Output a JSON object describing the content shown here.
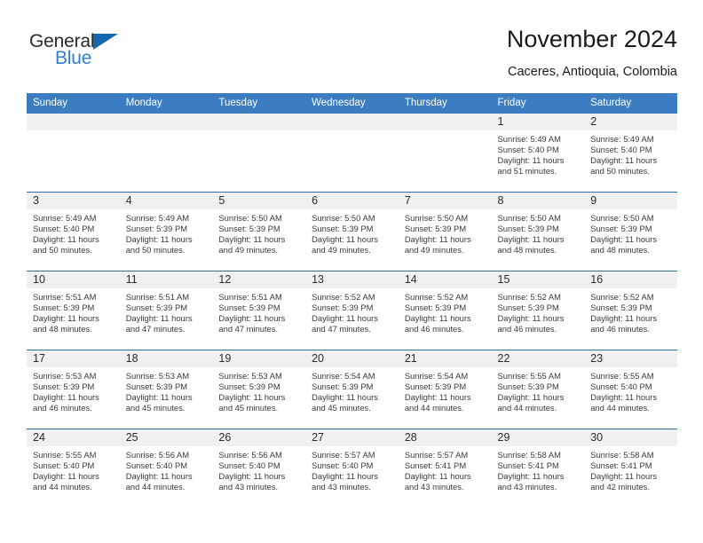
{
  "brand": {
    "name_part1": "General",
    "name_part2": "Blue",
    "triangle_icon": "triangle-icon",
    "color_dark": "#2b2b2b",
    "color_blue": "#2f7fd0",
    "triangle_color": "#1567b0"
  },
  "header": {
    "title": "November 2024",
    "subtitle": "Caceres, Antioquia, Colombia"
  },
  "theme": {
    "header_bg": "#3b7dc0",
    "header_text": "#ffffff",
    "row_divider": "#2f6fa8",
    "daynum_bg": "#f0f0f0",
    "body_text": "#3a3a3a"
  },
  "weekdays": [
    "Sunday",
    "Monday",
    "Tuesday",
    "Wednesday",
    "Thursday",
    "Friday",
    "Saturday"
  ],
  "weeks": [
    [
      {
        "day": "",
        "sunrise": "",
        "sunset": "",
        "daylight1": "",
        "daylight2": ""
      },
      {
        "day": "",
        "sunrise": "",
        "sunset": "",
        "daylight1": "",
        "daylight2": ""
      },
      {
        "day": "",
        "sunrise": "",
        "sunset": "",
        "daylight1": "",
        "daylight2": ""
      },
      {
        "day": "",
        "sunrise": "",
        "sunset": "",
        "daylight1": "",
        "daylight2": ""
      },
      {
        "day": "",
        "sunrise": "",
        "sunset": "",
        "daylight1": "",
        "daylight2": ""
      },
      {
        "day": "1",
        "sunrise": "Sunrise: 5:49 AM",
        "sunset": "Sunset: 5:40 PM",
        "daylight1": "Daylight: 11 hours",
        "daylight2": "and 51 minutes."
      },
      {
        "day": "2",
        "sunrise": "Sunrise: 5:49 AM",
        "sunset": "Sunset: 5:40 PM",
        "daylight1": "Daylight: 11 hours",
        "daylight2": "and 50 minutes."
      }
    ],
    [
      {
        "day": "3",
        "sunrise": "Sunrise: 5:49 AM",
        "sunset": "Sunset: 5:40 PM",
        "daylight1": "Daylight: 11 hours",
        "daylight2": "and 50 minutes."
      },
      {
        "day": "4",
        "sunrise": "Sunrise: 5:49 AM",
        "sunset": "Sunset: 5:39 PM",
        "daylight1": "Daylight: 11 hours",
        "daylight2": "and 50 minutes."
      },
      {
        "day": "5",
        "sunrise": "Sunrise: 5:50 AM",
        "sunset": "Sunset: 5:39 PM",
        "daylight1": "Daylight: 11 hours",
        "daylight2": "and 49 minutes."
      },
      {
        "day": "6",
        "sunrise": "Sunrise: 5:50 AM",
        "sunset": "Sunset: 5:39 PM",
        "daylight1": "Daylight: 11 hours",
        "daylight2": "and 49 minutes."
      },
      {
        "day": "7",
        "sunrise": "Sunrise: 5:50 AM",
        "sunset": "Sunset: 5:39 PM",
        "daylight1": "Daylight: 11 hours",
        "daylight2": "and 49 minutes."
      },
      {
        "day": "8",
        "sunrise": "Sunrise: 5:50 AM",
        "sunset": "Sunset: 5:39 PM",
        "daylight1": "Daylight: 11 hours",
        "daylight2": "and 48 minutes."
      },
      {
        "day": "9",
        "sunrise": "Sunrise: 5:50 AM",
        "sunset": "Sunset: 5:39 PM",
        "daylight1": "Daylight: 11 hours",
        "daylight2": "and 48 minutes."
      }
    ],
    [
      {
        "day": "10",
        "sunrise": "Sunrise: 5:51 AM",
        "sunset": "Sunset: 5:39 PM",
        "daylight1": "Daylight: 11 hours",
        "daylight2": "and 48 minutes."
      },
      {
        "day": "11",
        "sunrise": "Sunrise: 5:51 AM",
        "sunset": "Sunset: 5:39 PM",
        "daylight1": "Daylight: 11 hours",
        "daylight2": "and 47 minutes."
      },
      {
        "day": "12",
        "sunrise": "Sunrise: 5:51 AM",
        "sunset": "Sunset: 5:39 PM",
        "daylight1": "Daylight: 11 hours",
        "daylight2": "and 47 minutes."
      },
      {
        "day": "13",
        "sunrise": "Sunrise: 5:52 AM",
        "sunset": "Sunset: 5:39 PM",
        "daylight1": "Daylight: 11 hours",
        "daylight2": "and 47 minutes."
      },
      {
        "day": "14",
        "sunrise": "Sunrise: 5:52 AM",
        "sunset": "Sunset: 5:39 PM",
        "daylight1": "Daylight: 11 hours",
        "daylight2": "and 46 minutes."
      },
      {
        "day": "15",
        "sunrise": "Sunrise: 5:52 AM",
        "sunset": "Sunset: 5:39 PM",
        "daylight1": "Daylight: 11 hours",
        "daylight2": "and 46 minutes."
      },
      {
        "day": "16",
        "sunrise": "Sunrise: 5:52 AM",
        "sunset": "Sunset: 5:39 PM",
        "daylight1": "Daylight: 11 hours",
        "daylight2": "and 46 minutes."
      }
    ],
    [
      {
        "day": "17",
        "sunrise": "Sunrise: 5:53 AM",
        "sunset": "Sunset: 5:39 PM",
        "daylight1": "Daylight: 11 hours",
        "daylight2": "and 46 minutes."
      },
      {
        "day": "18",
        "sunrise": "Sunrise: 5:53 AM",
        "sunset": "Sunset: 5:39 PM",
        "daylight1": "Daylight: 11 hours",
        "daylight2": "and 45 minutes."
      },
      {
        "day": "19",
        "sunrise": "Sunrise: 5:53 AM",
        "sunset": "Sunset: 5:39 PM",
        "daylight1": "Daylight: 11 hours",
        "daylight2": "and 45 minutes."
      },
      {
        "day": "20",
        "sunrise": "Sunrise: 5:54 AM",
        "sunset": "Sunset: 5:39 PM",
        "daylight1": "Daylight: 11 hours",
        "daylight2": "and 45 minutes."
      },
      {
        "day": "21",
        "sunrise": "Sunrise: 5:54 AM",
        "sunset": "Sunset: 5:39 PM",
        "daylight1": "Daylight: 11 hours",
        "daylight2": "and 44 minutes."
      },
      {
        "day": "22",
        "sunrise": "Sunrise: 5:55 AM",
        "sunset": "Sunset: 5:39 PM",
        "daylight1": "Daylight: 11 hours",
        "daylight2": "and 44 minutes."
      },
      {
        "day": "23",
        "sunrise": "Sunrise: 5:55 AM",
        "sunset": "Sunset: 5:40 PM",
        "daylight1": "Daylight: 11 hours",
        "daylight2": "and 44 minutes."
      }
    ],
    [
      {
        "day": "24",
        "sunrise": "Sunrise: 5:55 AM",
        "sunset": "Sunset: 5:40 PM",
        "daylight1": "Daylight: 11 hours",
        "daylight2": "and 44 minutes."
      },
      {
        "day": "25",
        "sunrise": "Sunrise: 5:56 AM",
        "sunset": "Sunset: 5:40 PM",
        "daylight1": "Daylight: 11 hours",
        "daylight2": "and 44 minutes."
      },
      {
        "day": "26",
        "sunrise": "Sunrise: 5:56 AM",
        "sunset": "Sunset: 5:40 PM",
        "daylight1": "Daylight: 11 hours",
        "daylight2": "and 43 minutes."
      },
      {
        "day": "27",
        "sunrise": "Sunrise: 5:57 AM",
        "sunset": "Sunset: 5:40 PM",
        "daylight1": "Daylight: 11 hours",
        "daylight2": "and 43 minutes."
      },
      {
        "day": "28",
        "sunrise": "Sunrise: 5:57 AM",
        "sunset": "Sunset: 5:41 PM",
        "daylight1": "Daylight: 11 hours",
        "daylight2": "and 43 minutes."
      },
      {
        "day": "29",
        "sunrise": "Sunrise: 5:58 AM",
        "sunset": "Sunset: 5:41 PM",
        "daylight1": "Daylight: 11 hours",
        "daylight2": "and 43 minutes."
      },
      {
        "day": "30",
        "sunrise": "Sunrise: 5:58 AM",
        "sunset": "Sunset: 5:41 PM",
        "daylight1": "Daylight: 11 hours",
        "daylight2": "and 42 minutes."
      }
    ]
  ]
}
